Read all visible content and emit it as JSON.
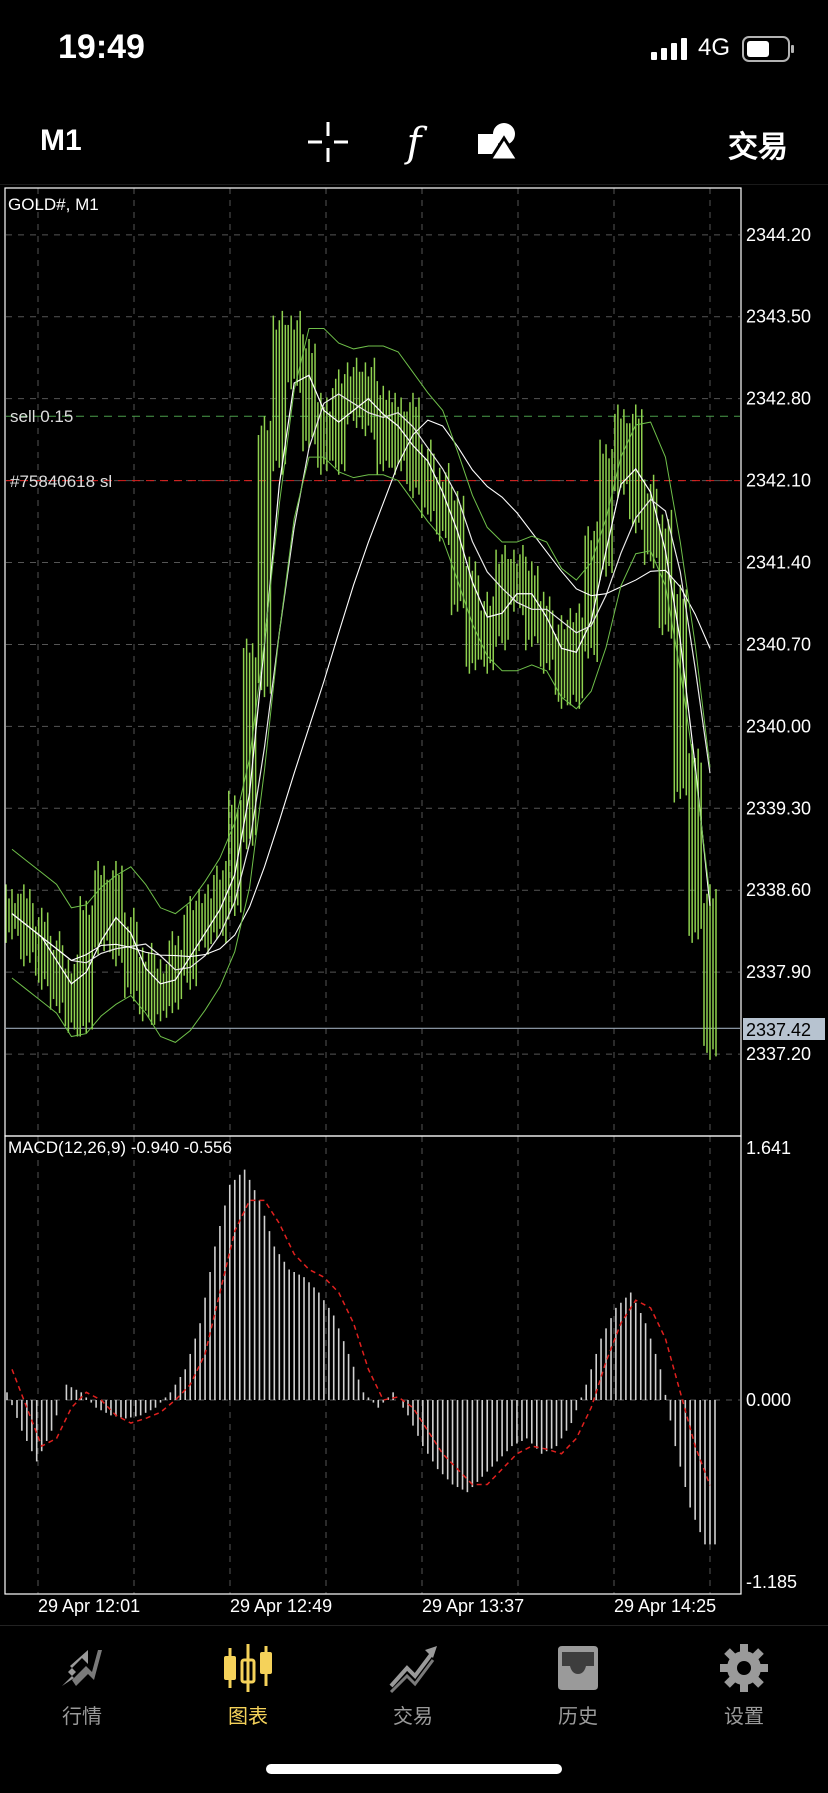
{
  "status_bar": {
    "time": "19:49",
    "network": "4G"
  },
  "toolbar": {
    "period": "M1",
    "trade": "交易",
    "icons": [
      "crosshair-icon",
      "function-icon",
      "objects-icon"
    ]
  },
  "chart": {
    "symbol_label": "GOLD#, M1",
    "price_ticks": [
      "2344.20",
      "2343.50",
      "2342.80",
      "2342.10",
      "2341.40",
      "2340.70",
      "2340.00",
      "2339.30",
      "2338.60",
      "2337.90",
      "2337.20"
    ],
    "current_price": "2337.42",
    "sell_line_label": "sell 0.15",
    "sl_line_label": "#75840618 sl",
    "macd_label": "MACD(12,26,9) -0.940 -0.556",
    "macd_ticks": [
      "1.641",
      "0.000",
      "-1.185"
    ],
    "time_labels": [
      "29 Apr 12:01",
      "29 Apr 12:49",
      "29 Apr 13:37",
      "29 Apr 14:25"
    ],
    "colors": {
      "candle": "#8fd14f",
      "signal": "#e0201e",
      "sl": "#e0201e",
      "sell": "#4a9e4a"
    }
  },
  "chart_data": {
    "type": "line",
    "price_ylim": [
      2336.5,
      2344.6
    ],
    "current_price": 2337.42,
    "sell_level": 2342.65,
    "sl_level": 2342.1,
    "price_close": [
      2338.4,
      2338.2,
      2338.0,
      2337.8,
      2337.6,
      2338.3,
      2338.6,
      2338.2,
      2337.9,
      2337.7,
      2337.8,
      2338.0,
      2338.3,
      2338.4,
      2338.6,
      2339.2,
      2340.5,
      2342.4,
      2343.3,
      2343.1,
      2342.6,
      2342.4,
      2342.8,
      2342.9,
      2342.7,
      2342.4,
      2342.6,
      2342.2,
      2342.0,
      2341.8,
      2341.2,
      2340.7,
      2340.9,
      2341.3,
      2341.2,
      2340.9,
      2340.7,
      2340.4,
      2340.8,
      2341.5,
      2342.2,
      2342.5,
      2341.9,
      2341.6,
      2341.0,
      2339.6,
      2338.4,
      2337.4
    ],
    "macd_ylim": [
      -1.185,
      1.641
    ],
    "macd": [
      0.05,
      -0.2,
      -0.4,
      -0.2,
      0.1,
      0.05,
      -0.05,
      -0.1,
      -0.12,
      -0.1,
      -0.05,
      0.05,
      0.2,
      0.5,
      1.0,
      1.4,
      1.5,
      1.3,
      1.0,
      0.85,
      0.8,
      0.7,
      0.55,
      0.3,
      0.05,
      -0.05,
      0.05,
      -0.1,
      -0.3,
      -0.45,
      -0.55,
      -0.6,
      -0.5,
      -0.4,
      -0.3,
      -0.25,
      -0.35,
      -0.3,
      -0.15,
      0.1,
      0.4,
      0.6,
      0.7,
      0.5,
      0.2,
      -0.3,
      -0.7,
      -0.94
    ],
    "signal": [
      0.2,
      -0.05,
      -0.3,
      -0.25,
      -0.05,
      0.05,
      0.0,
      -0.1,
      -0.15,
      -0.12,
      -0.08,
      0.0,
      0.1,
      0.3,
      0.7,
      1.1,
      1.3,
      1.3,
      1.15,
      0.95,
      0.85,
      0.8,
      0.7,
      0.5,
      0.2,
      0.0,
      0.02,
      -0.05,
      -0.2,
      -0.35,
      -0.45,
      -0.55,
      -0.55,
      -0.45,
      -0.35,
      -0.3,
      -0.32,
      -0.35,
      -0.25,
      -0.05,
      0.25,
      0.5,
      0.65,
      0.6,
      0.4,
      0.05,
      -0.3,
      -0.556
    ]
  },
  "nav": [
    {
      "label": "行情",
      "icon": "quotes-icon"
    },
    {
      "label": "图表",
      "icon": "chart-candles-icon"
    },
    {
      "label": "交易",
      "icon": "trade-icon"
    },
    {
      "label": "历史",
      "icon": "history-icon"
    },
    {
      "label": "设置",
      "icon": "settings-icon"
    }
  ]
}
